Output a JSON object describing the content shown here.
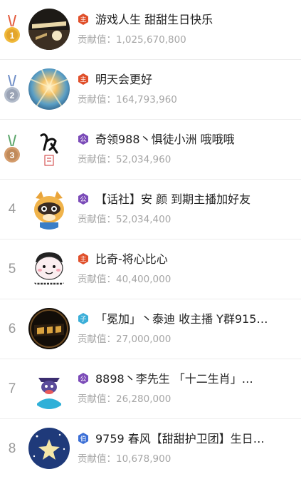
{
  "contribution_label": "贡献值：",
  "rows": [
    {
      "rank": "1",
      "badge_icon": "host-badge-icon",
      "badge_color": "#e04f2a",
      "badge_char": "主",
      "name": "游戏人生 甜甜生日快乐",
      "value": "1,025,670,800"
    },
    {
      "rank": "2",
      "badge_icon": "host-badge-icon",
      "badge_color": "#e04f2a",
      "badge_char": "主",
      "name": "明天会更好",
      "value": "164,793,960"
    },
    {
      "rank": "3",
      "badge_icon": "duke-badge-icon",
      "badge_color": "#7b4bb8",
      "badge_char": "公",
      "name": "奇领988丶惧徒小洲 哦哦哦",
      "value": "52,034,960"
    },
    {
      "rank": "4",
      "badge_icon": "duke-badge-icon",
      "badge_color": "#7b4bb8",
      "badge_char": "公",
      "name": "【话社】安 颜 到期主播加好友",
      "value": "52,034,400"
    },
    {
      "rank": "5",
      "badge_icon": "host-badge-icon",
      "badge_color": "#e04f2a",
      "badge_char": "主",
      "name": "比奇-将心比心",
      "value": "40,400,000"
    },
    {
      "rank": "6",
      "badge_icon": "viscount-badge-icon",
      "badge_color": "#3aaed8",
      "badge_char": "子",
      "name": "「冕加」丶泰迪 收主播 Y群915…",
      "value": "27,000,000"
    },
    {
      "rank": "7",
      "badge_icon": "duke-badge-icon",
      "badge_color": "#7b4bb8",
      "badge_char": "公",
      "name": "8898丶李先生 「十二生肖」…",
      "value": "26,280,000"
    },
    {
      "rank": "8",
      "badge_icon": "earl-badge-icon",
      "badge_color": "#3b6fd6",
      "badge_char": "伯",
      "name": "9759 春风【甜甜护卫团】生日…",
      "value": "10,678,900"
    }
  ],
  "medal_colors": {
    "gold": "#e3a52c",
    "silver": "#9aa3b5",
    "bronze": "#c08a5a",
    "ribbon_gold": "#e35a3c",
    "ribbon_silver": "#6f8ec7",
    "ribbon_bronze": "#5aa56a"
  }
}
